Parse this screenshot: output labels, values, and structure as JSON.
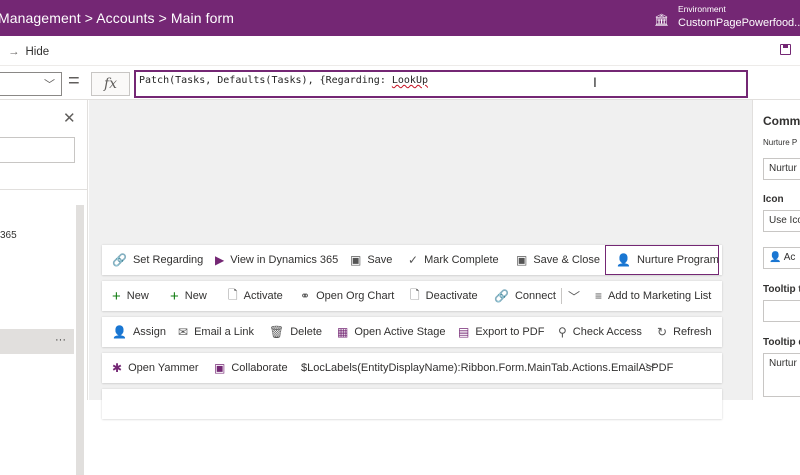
{
  "header": {
    "breadcrumb": "Management > Accounts > Main form",
    "environment_label": "Environment",
    "environment_name": "CustomPagePowerfood...",
    "bg": "#742774"
  },
  "commandbar": {
    "hide_label": "Hide"
  },
  "formula_bar": {
    "fx": "fx",
    "eq": "=",
    "formula_ok": "Patch(Tasks, Defaults(Tasks), {Regarding: ",
    "formula_err": "LookUp"
  },
  "left_panel": {
    "item_365": "365",
    "more": "···"
  },
  "right_panel": {
    "title": "Comma",
    "subtitle": "Nurture P",
    "box1": "Nurtur",
    "icon_label": "Icon",
    "icon_value": "Use Ico",
    "box2": "Ac",
    "tooltip1": "Tooltip t",
    "tooltip2": "Tooltip d",
    "box4": "Nurtur"
  },
  "ribbons": [
    [
      {
        "name": "set-regarding-button",
        "icon": "link-icon",
        "glyph": "🔗",
        "label": "Set Regarding"
      },
      {
        "name": "view-in-dynamics-button",
        "icon": "dynamics-icon",
        "glyph": "▶",
        "label": "View in Dynamics 365"
      },
      {
        "name": "save-button",
        "icon": "save-icon",
        "glyph": "💾",
        "label": "Save"
      },
      {
        "name": "mark-complete-button",
        "icon": "check-icon",
        "glyph": "✓",
        "label": "Mark Complete"
      },
      {
        "name": "save-close-button",
        "icon": "save-close-icon",
        "glyph": "💾",
        "label": "Save & Close"
      },
      {
        "name": "nurture-program-button",
        "icon": "person-icon",
        "glyph": "👤",
        "label": "Nurture Program",
        "highlight": true
      }
    ],
    [
      {
        "name": "new-button-1",
        "icon": "plus-icon",
        "glyph": "+",
        "label": "New",
        "green": true
      },
      {
        "name": "new-button-2",
        "icon": "plus-icon",
        "glyph": "+",
        "label": "New",
        "green": true
      },
      {
        "name": "activate-button",
        "icon": "document-icon",
        "glyph": "📄",
        "label": "Activate"
      },
      {
        "name": "open-org-chart-button",
        "icon": "org-chart-icon",
        "glyph": "⚭",
        "label": "Open Org Chart"
      },
      {
        "name": "deactivate-button",
        "icon": "document-icon",
        "glyph": "📄",
        "label": "Deactivate"
      },
      {
        "name": "connect-button",
        "icon": "connect-icon",
        "glyph": "🔗",
        "label": "Connect"
      },
      {
        "name": "more-chevron-button",
        "icon": "chevron-down-icon",
        "glyph": "⌄",
        "label": ""
      },
      {
        "name": "add-to-marketing-list-button",
        "icon": "list-add-icon",
        "glyph": "≡",
        "label": "Add to Marketing List"
      }
    ],
    [
      {
        "name": "assign-button",
        "icon": "person-assign-icon",
        "glyph": "👤",
        "label": "Assign"
      },
      {
        "name": "email-a-link-button",
        "icon": "email-icon",
        "glyph": "✉",
        "label": "Email a Link"
      },
      {
        "name": "delete-button",
        "icon": "trash-icon",
        "glyph": "🗑",
        "label": "Delete"
      },
      {
        "name": "open-active-stage-button",
        "icon": "stage-icon",
        "glyph": "▦",
        "label": "Open Active Stage"
      },
      {
        "name": "export-to-pdf-button",
        "icon": "pdf-icon",
        "glyph": "▤",
        "label": "Export to PDF"
      },
      {
        "name": "check-access-button",
        "icon": "key-icon",
        "glyph": "🔍",
        "label": "Check Access"
      },
      {
        "name": "refresh-button",
        "icon": "refresh-icon",
        "glyph": "↻",
        "label": "Refresh"
      }
    ],
    [
      {
        "name": "open-yammer-button",
        "icon": "yammer-icon",
        "glyph": "✱",
        "label": "Open Yammer",
        "purple": true
      },
      {
        "name": "collaborate-button",
        "icon": "teams-icon",
        "glyph": "▣",
        "label": "Collaborate",
        "purple": true
      },
      {
        "name": "email-as-pdf-button",
        "icon": "",
        "glyph": "",
        "label": "$LocLabels(EntityDisplayName):Ribbon.Form.MainTab.Actions.EmailAsPDF"
      },
      {
        "name": "email-pdf-chevron-button",
        "icon": "chevron-down-icon",
        "glyph": "⌄",
        "label": ""
      }
    ]
  ]
}
